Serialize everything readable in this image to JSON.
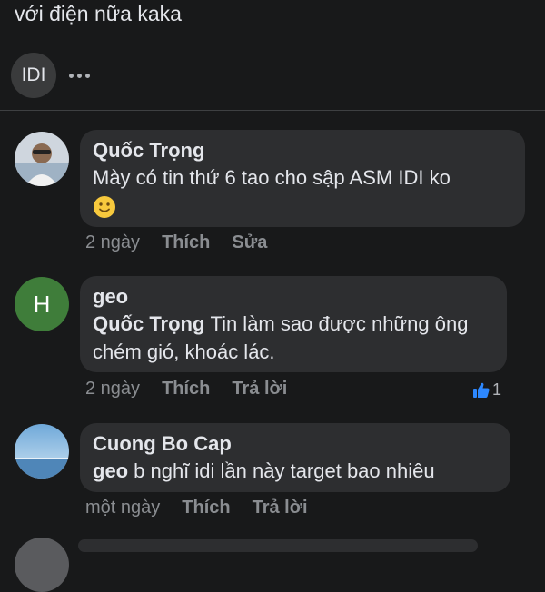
{
  "post": {
    "text_tail": "với điện nữa kaka",
    "meta_avatar_label": "IDI"
  },
  "comments": [
    {
      "author": "Quốc Trọng",
      "text": "Mày có tin thứ 6 tao cho sập ASM IDI ko",
      "time": "2 ngày",
      "actions": [
        "Thích",
        "Sửa"
      ],
      "emoji": "slightly-smiling-face"
    },
    {
      "author": "geo",
      "avatar_letter": "H",
      "mention": "Quốc Trọng",
      "text": "Tin làm sao được những ông chém gió, khoác lác.",
      "time": "2 ngày",
      "actions": [
        "Thích",
        "Trả lời"
      ],
      "reaction_count": "1",
      "reaction_icon": "thumbs-up-icon"
    },
    {
      "author": "Cuong Bo Cap",
      "mention": "geo",
      "text": "b nghĩ idi lần này target bao nhiêu",
      "time": "một ngày",
      "actions": [
        "Thích",
        "Trả lời"
      ]
    }
  ],
  "colors": {
    "background": "#18191a",
    "bubble": "#2d2e30",
    "avatar_h": "#3f7d3a",
    "like_blue": "#2d88ff"
  }
}
